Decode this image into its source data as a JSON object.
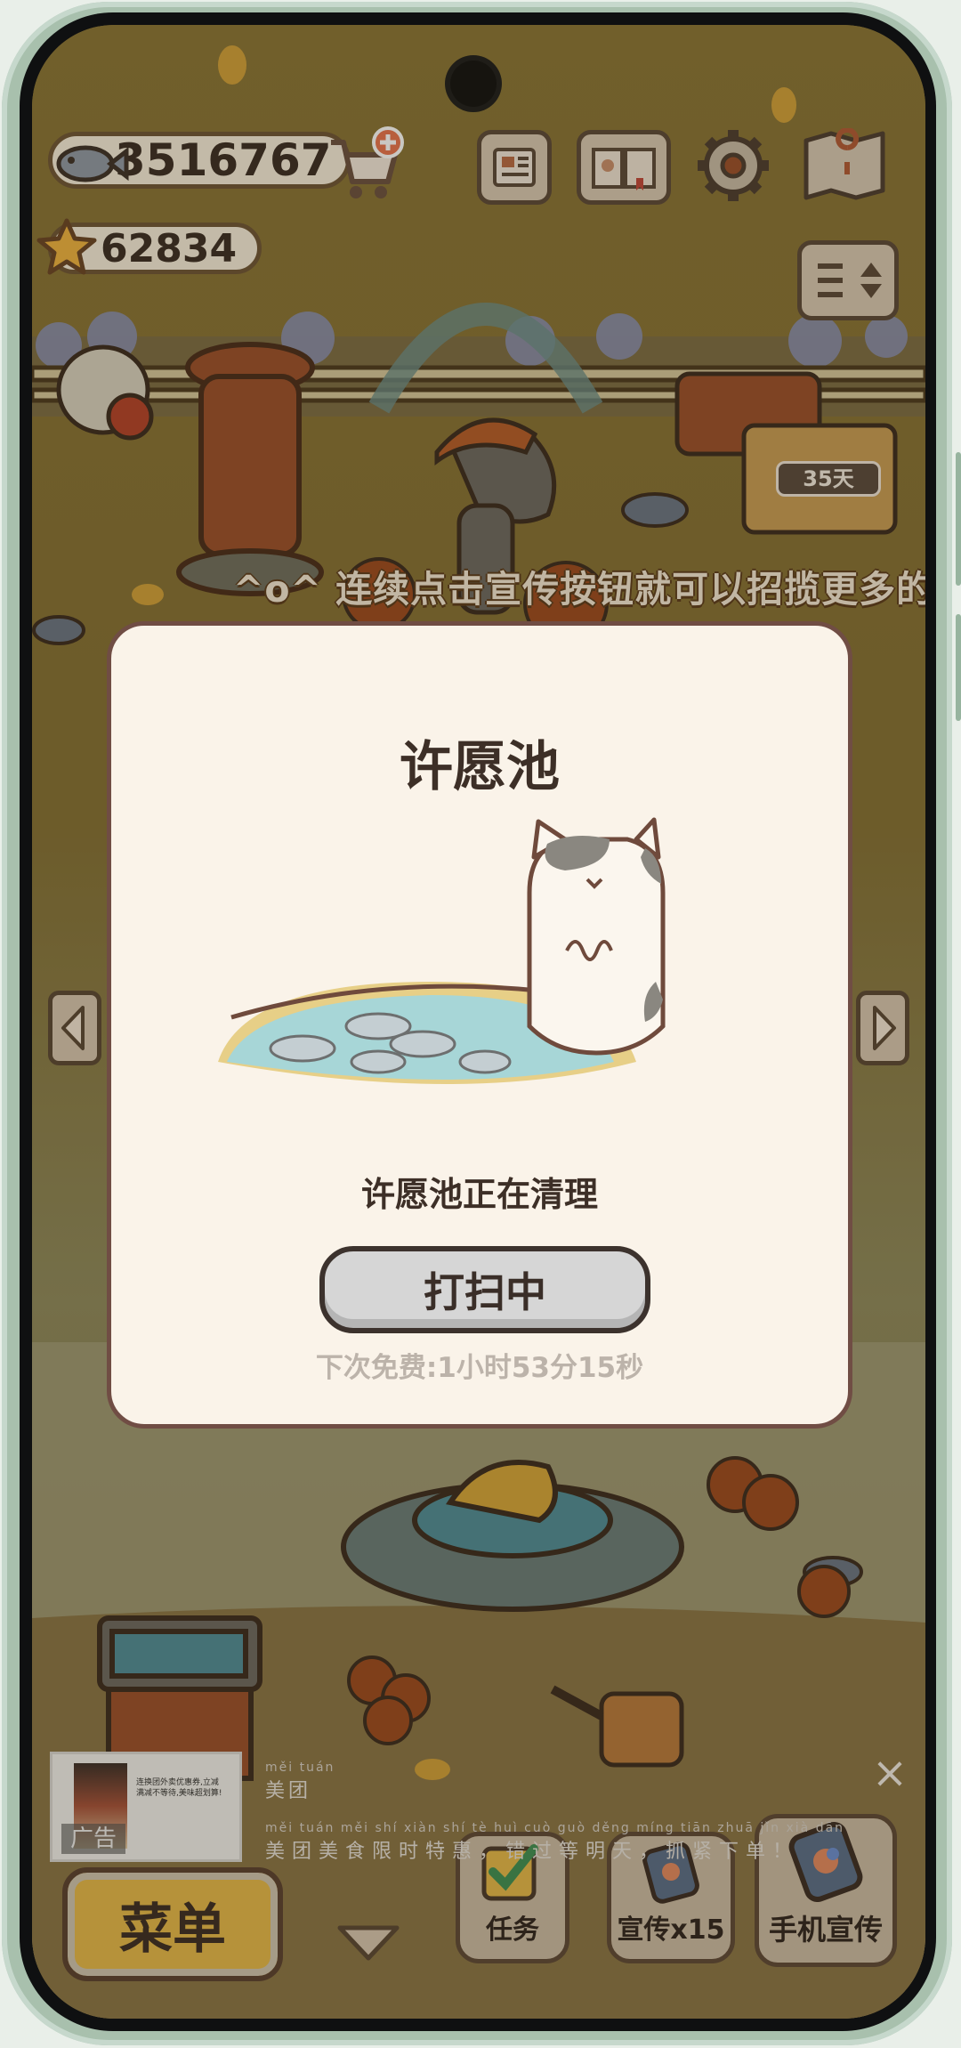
{
  "hud": {
    "fish_count": "3516767",
    "star_count": "62834",
    "days_badge": "35天"
  },
  "marquee_text": "^o^ 连续点击宣传按钮就可以招揽更多的顾",
  "modal": {
    "title": "许愿池",
    "status": "许愿池正在清理",
    "button_label": "打扫中",
    "timer": "下次免费:1小时53分15秒"
  },
  "ad": {
    "label": "广告",
    "brand": "美团",
    "brand_pinyin": "měi tuán",
    "slogan": "美团美食限时特惠，错过等明天，抓紧下单！",
    "slogan_pinyin": "měi tuán měi shí xiàn shí tè huì   cuò guò děng míng tiān   zhuā jǐn xià dān",
    "thumb_text": "连换团外卖优惠券,立减满减不等待,美味超划算!",
    "close": "×"
  },
  "bottom": {
    "menu_label": "菜单",
    "task_label": "任务",
    "promo_label": "宣传x15",
    "phone_promo_label": "手机宣传"
  },
  "colors": {
    "modal_bg": "#faf3e9",
    "frame": "#a8c0ad",
    "scene": "#847035"
  }
}
